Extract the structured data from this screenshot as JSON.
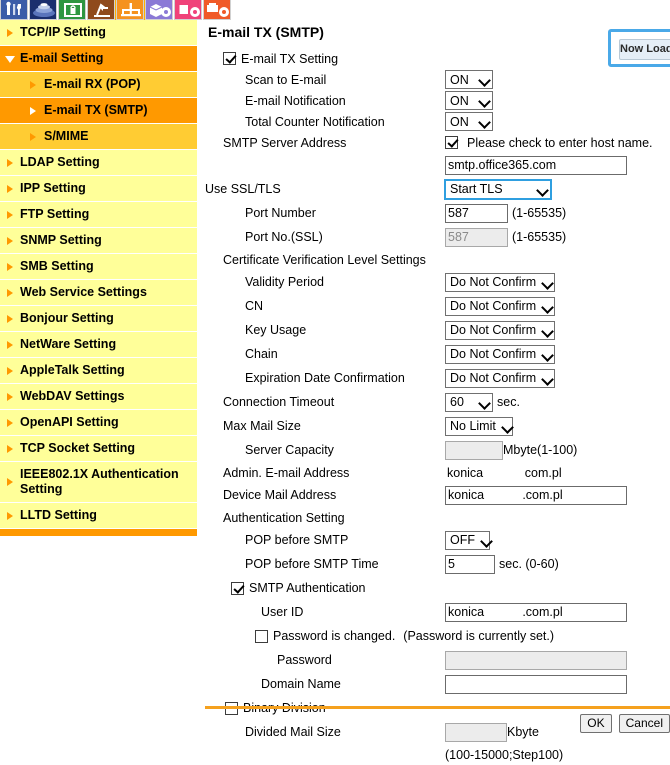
{
  "iconbar": {
    "tabs": [
      {
        "name": "maintenance-icon",
        "color": "#3b5ca8",
        "label": "Maintenance",
        "active": false
      },
      {
        "name": "scan-icon",
        "color": "#1b2f6e",
        "label": "Scan",
        "active": false
      },
      {
        "name": "security-icon",
        "color": "#2e9641",
        "label": "Security",
        "active": false
      },
      {
        "name": "print-icon",
        "color": "#8f4a1c",
        "label": "Print",
        "active": false
      },
      {
        "name": "network-icon",
        "color": "#f5921e",
        "label": "Network",
        "active": true
      },
      {
        "name": "box-icon",
        "color": "#8b79d6",
        "label": "Box",
        "active": false
      },
      {
        "name": "fax-icon",
        "color": "#f0427a",
        "label": "Fax",
        "active": false
      },
      {
        "name": "system-icon",
        "color": "#f05a28",
        "label": "System",
        "active": false
      }
    ]
  },
  "sidebar": {
    "items": [
      {
        "label": "TCP/IP Setting",
        "level": 0,
        "selected": false,
        "marker": "triangle-right"
      },
      {
        "label": "E-mail Setting",
        "level": 0,
        "selected": true,
        "marker": "triangle-down"
      },
      {
        "label": "E-mail RX (POP)",
        "level": 1,
        "selected": false,
        "marker": "triangle-right"
      },
      {
        "label": "E-mail TX (SMTP)",
        "level": 1,
        "selected": true,
        "marker": "triangle-right"
      },
      {
        "label": "S/MIME",
        "level": 1,
        "selected": false,
        "marker": "triangle-right"
      },
      {
        "label": "LDAP Setting",
        "level": 0,
        "selected": false,
        "marker": "triangle-right"
      },
      {
        "label": "IPP Setting",
        "level": 0,
        "selected": false,
        "marker": "triangle-right"
      },
      {
        "label": "FTP Setting",
        "level": 0,
        "selected": false,
        "marker": "triangle-right"
      },
      {
        "label": "SNMP Setting",
        "level": 0,
        "selected": false,
        "marker": "triangle-right"
      },
      {
        "label": "SMB Setting",
        "level": 0,
        "selected": false,
        "marker": "triangle-right"
      },
      {
        "label": "Web Service Settings",
        "level": 0,
        "selected": false,
        "marker": "triangle-right"
      },
      {
        "label": "Bonjour Setting",
        "level": 0,
        "selected": false,
        "marker": "triangle-right"
      },
      {
        "label": "NetWare Setting",
        "level": 0,
        "selected": false,
        "marker": "triangle-right"
      },
      {
        "label": "AppleTalk Setting",
        "level": 0,
        "selected": false,
        "marker": "triangle-right"
      },
      {
        "label": "WebDAV Settings",
        "level": 0,
        "selected": false,
        "marker": "triangle-right"
      },
      {
        "label": "OpenAPI Setting",
        "level": 0,
        "selected": false,
        "marker": "triangle-right"
      },
      {
        "label": "TCP Socket Setting",
        "level": 0,
        "selected": false,
        "marker": "triangle-right"
      },
      {
        "label": "IEEE802.1X Authentication Setting",
        "level": 0,
        "selected": false,
        "marker": "triangle-right"
      },
      {
        "label": "LLTD Setting",
        "level": 0,
        "selected": false,
        "marker": "triangle-right"
      }
    ]
  },
  "page": {
    "title": "E-mail TX (SMTP)",
    "now_loading_label": "Now Loading..."
  },
  "form": {
    "email_tx_setting": {
      "label": "E-mail TX Setting",
      "checked": true
    },
    "scan_to_email": {
      "label": "Scan to E-mail",
      "value": "ON"
    },
    "email_notification": {
      "label": "E-mail Notification",
      "value": "ON"
    },
    "total_counter_notification": {
      "label": "Total Counter Notification",
      "value": "ON"
    },
    "smtp_server_address": {
      "label": "SMTP Server Address",
      "hostname_checkbox_label": "Please check to enter host name.",
      "hostname_checked": true,
      "value": "smtp.office365.com"
    },
    "use_ssl_tls": {
      "label": "Use SSL/TLS",
      "value": "Start TLS",
      "focused": true
    },
    "port_number": {
      "label": "Port Number",
      "value": "587",
      "range": "(1-65535)"
    },
    "port_number_ssl": {
      "label": "Port No.(SSL)",
      "value": "587",
      "range": "(1-65535)",
      "disabled": true
    },
    "certificate_section_label": "Certificate Verification Level Settings",
    "validity_period": {
      "label": "Validity Period",
      "value": "Do Not Confirm"
    },
    "cn": {
      "label": "CN",
      "value": "Do Not Confirm"
    },
    "key_usage": {
      "label": "Key Usage",
      "value": "Do Not Confirm"
    },
    "chain": {
      "label": "Chain",
      "value": "Do Not Confirm"
    },
    "expiration_date_confirmation": {
      "label": "Expiration Date Confirmation",
      "value": "Do Not Confirm"
    },
    "connection_timeout": {
      "label": "Connection Timeout",
      "value": "60",
      "unit": "sec."
    },
    "max_mail_size": {
      "label": "Max Mail Size",
      "value": "No Limit"
    },
    "server_capacity": {
      "label": "Server Capacity",
      "value": "",
      "unit": "Mbyte(1-100)",
      "disabled": true
    },
    "admin_email_address": {
      "label": "Admin. E-mail Address",
      "value": "konica            com.pl"
    },
    "device_mail_address": {
      "label": "Device Mail Address",
      "value": "konica           .com.pl"
    },
    "authentication_section_label": "Authentication Setting",
    "pop_before_smtp": {
      "label": "POP before SMTP",
      "value": "OFF"
    },
    "pop_before_smtp_time": {
      "label": "POP before SMTP Time",
      "value": "5",
      "unit": "sec. (0-60)"
    },
    "smtp_authentication": {
      "label": "SMTP Authentication",
      "checked": true
    },
    "user_id": {
      "label": "User ID",
      "value": "konica           .com.pl"
    },
    "password_is_changed": {
      "label": "Password is changed.",
      "note": "(Password is currently set.)",
      "checked": false
    },
    "password": {
      "label": "Password",
      "value": "",
      "disabled": true
    },
    "domain_name": {
      "label": "Domain Name",
      "value": ""
    },
    "binary_division": {
      "label": "Binary Division",
      "checked": false
    },
    "divided_mail_size": {
      "label": "Divided Mail Size",
      "value": "",
      "unit": "Kbyte",
      "range": "(100-15000;Step100)",
      "disabled": true
    }
  },
  "footer": {
    "ok_label": "OK",
    "cancel_label": "Cancel"
  },
  "colors": {
    "sidebar_bg": "#ffffcc",
    "nav_level0": "#ffff99",
    "nav_level1": "#ffcc33",
    "nav_selected": "#ff9900",
    "accent_rule": "#f5a11e",
    "focus_blue": "#4aa9e8"
  }
}
